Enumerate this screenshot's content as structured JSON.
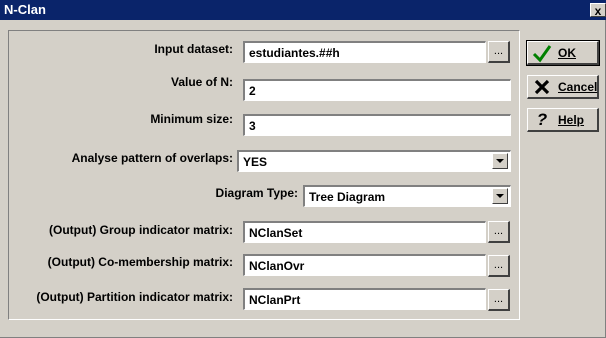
{
  "window": {
    "title": "N-Clan",
    "close_label": "x"
  },
  "form": {
    "input_dataset": {
      "label": "Input dataset:",
      "value": "estudiantes.##h",
      "browse_label": "..."
    },
    "value_n": {
      "label": "Value of N:",
      "value": "2"
    },
    "min_size": {
      "label": "Minimum size:",
      "value": "3"
    },
    "overlaps": {
      "label": "Analyse pattern of overlaps:",
      "value": "YES"
    },
    "diagram_type": {
      "label": "Diagram Type:",
      "value": "Tree Diagram"
    },
    "group_matrix": {
      "label": "(Output) Group indicator matrix:",
      "value": "NClanSet",
      "browse_label": "..."
    },
    "comembership": {
      "label": "(Output) Co-membership matrix:",
      "value": "NClanOvr",
      "browse_label": "..."
    },
    "partition": {
      "label": "(Output) Partition indicator matrix:",
      "value": "NClanPrt",
      "browse_label": "..."
    }
  },
  "buttons": {
    "ok": {
      "label": "OK",
      "icon": "check-icon",
      "icon_color": "#008000"
    },
    "cancel": {
      "label": "Cancel",
      "icon": "x-icon",
      "icon_color": "#000000"
    },
    "help": {
      "label": "Help",
      "icon": "question-icon",
      "icon_color": "#000000"
    }
  },
  "colors": {
    "titlebar": "#0a246a",
    "face": "#d4d0c8"
  }
}
